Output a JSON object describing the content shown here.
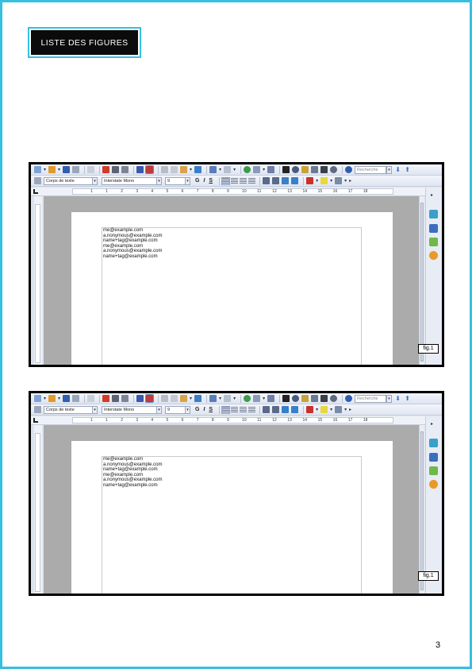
{
  "page": {
    "title": "LISTE DES FIGURES",
    "page_number": "3"
  },
  "colors": {
    "frame_border": "#35c0e0",
    "title_background": "#0b0b0b",
    "workspace_gray": "#ababab"
  },
  "figures": [
    {
      "caption": "fig.1",
      "toolbar": {
        "search_placeholder": "Recherche",
        "paragraph_style": "Corps de texte",
        "font_name": "Interstate Mono",
        "font_size": "9",
        "bold_label": "G",
        "italic_label": "I",
        "underline_label": "S"
      },
      "ruler_numbers": [
        "1",
        "1",
        "2",
        "3",
        "4",
        "5",
        "6",
        "7",
        "8",
        "9",
        "10",
        "11",
        "12",
        "13",
        "14",
        "15",
        "16",
        "17",
        "18"
      ],
      "document_lines": [
        "me@example.com",
        "a.nonymous@example.com",
        "name+tag@example.com",
        "me@example.com",
        "a.nonymous@example.com",
        "name+tag@example.com"
      ]
    },
    {
      "caption": "fig.1",
      "toolbar": {
        "search_placeholder": "Recherche",
        "paragraph_style": "Corps de texte",
        "font_name": "Interstate Mono",
        "font_size": "9",
        "bold_label": "G",
        "italic_label": "I",
        "underline_label": "S"
      },
      "ruler_numbers": [
        "1",
        "1",
        "2",
        "3",
        "4",
        "5",
        "6",
        "7",
        "8",
        "9",
        "10",
        "11",
        "12",
        "13",
        "14",
        "15",
        "16",
        "17",
        "18"
      ],
      "document_lines": [
        "me@example.com",
        "a.nonymous@example.com",
        "name+tag@example.com",
        "me@example.com",
        "a.nonymous@example.com",
        "name+tag@example.com"
      ]
    }
  ]
}
